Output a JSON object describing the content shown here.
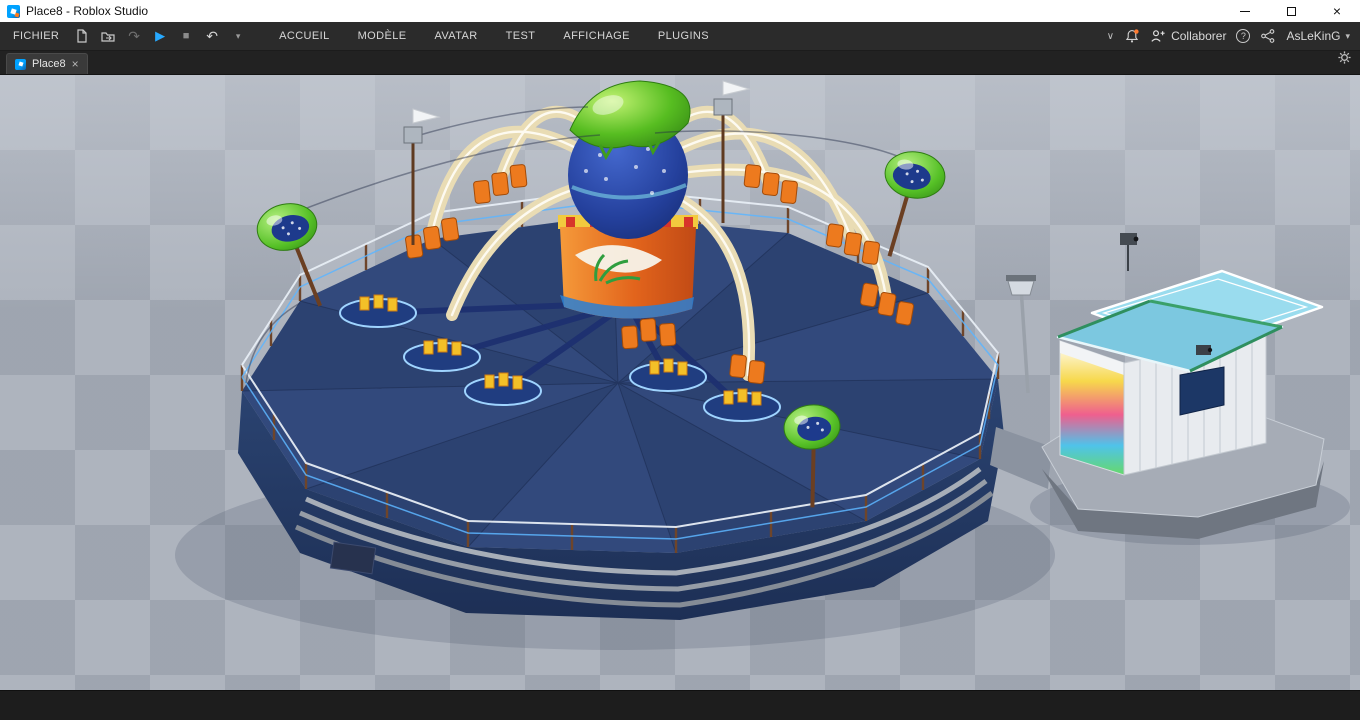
{
  "window": {
    "title": "Place8 - Roblox Studio"
  },
  "titlebar": {
    "close_glyph": "×"
  },
  "menubar": {
    "file_label": "FICHIER",
    "ribbon_tabs": [
      {
        "label": "ACCUEIL"
      },
      {
        "label": "MODÈLE"
      },
      {
        "label": "AVATAR"
      },
      {
        "label": "TEST"
      },
      {
        "label": "AFFICHAGE"
      },
      {
        "label": "PLUGINS"
      }
    ],
    "collaborate_label": "Collaborer",
    "username": "AsLeKinG",
    "help_glyph": "?"
  },
  "toolbar": {
    "play_glyph": "▶",
    "stop_glyph": "■",
    "undo_glyph": "↶",
    "redo_glyph": "↷",
    "overflow_glyph": "▾",
    "ribbon_collapse_glyph": "∨",
    "user_caret_glyph": "▾"
  },
  "document_tabs": {
    "tabs": [
      {
        "label": "Place8",
        "active": true,
        "close_glyph": "×"
      }
    ]
  },
  "viewport_colors": {
    "ground": "#aeb4be",
    "ground_checker": "#9aa1ac",
    "platform_navy": "#32497c",
    "platform_skirt": "#243a66",
    "arch_cream": "#f0e6c8",
    "ride_orange": "#ed7a1e",
    "seat_yellow": "#f3c028",
    "pod_green": "#5fc62e",
    "booth_roof_blue": "#8fd4ea",
    "accent_play_blue": "#27a9ff"
  }
}
